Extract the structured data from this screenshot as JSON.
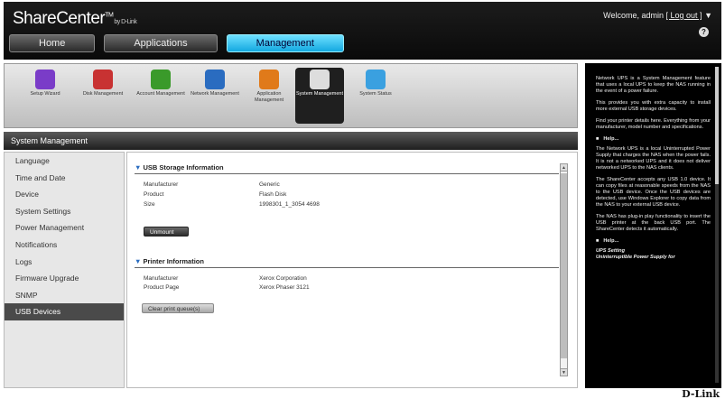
{
  "header": {
    "brand": "ShareCenter",
    "brand_tm": "TM",
    "brand_by": "by D-Link",
    "welcome": "Welcome, admin",
    "logout": "[ Log out ]",
    "dropdown_glyph": "▼",
    "help_glyph": "?"
  },
  "tabs": [
    {
      "label": "Home"
    },
    {
      "label": "Applications"
    },
    {
      "label": "Management"
    }
  ],
  "tools": [
    {
      "label": "Setup Wizard",
      "icon": "wizard-icon",
      "color": "#7a3cc8"
    },
    {
      "label": "Disk Management",
      "icon": "disk-icon",
      "color": "#c83232"
    },
    {
      "label": "Account Management",
      "icon": "account-icon",
      "color": "#3a9a2a"
    },
    {
      "label": "Network Management",
      "icon": "network-icon",
      "color": "#2a6cc0"
    },
    {
      "label": "Application Management",
      "icon": "application-icon",
      "color": "#e07a1a"
    },
    {
      "label": "System Management",
      "icon": "system-gear-icon",
      "color": "#dddddd"
    },
    {
      "label": "System Status",
      "icon": "info-icon",
      "color": "#3aa0e0"
    }
  ],
  "section_title": "System Management",
  "nav": [
    {
      "label": "Language"
    },
    {
      "label": "Time and Date"
    },
    {
      "label": "Device"
    },
    {
      "label": "System Settings"
    },
    {
      "label": "Power Management"
    },
    {
      "label": "Notifications"
    },
    {
      "label": "Logs"
    },
    {
      "label": "Firmware Upgrade"
    },
    {
      "label": "SNMP"
    },
    {
      "label": "USB Devices"
    }
  ],
  "usb_storage": {
    "title": "USB Storage Information",
    "rows": [
      {
        "key": "Manufacturer",
        "value": "Generic"
      },
      {
        "key": "Product",
        "value": "Flash Disk"
      },
      {
        "key": "Size",
        "value": "1998301_1_3054 4698"
      }
    ],
    "unmount_label": "Unmount"
  },
  "printer": {
    "title": "Printer Information",
    "rows": [
      {
        "key": "Manufacturer",
        "value": "Xerox Corporation"
      },
      {
        "key": "Product Page",
        "value": "Xerox Phaser 3121"
      }
    ],
    "clear_label": "Clear print queue(s)"
  },
  "help": {
    "p1": "Network UPS is a System Management feature that uses a local UPS to keep the NAS running in the event of a power failure.",
    "p2": "This provides you with extra capacity to install more external USB storage devices.",
    "p3": "Find your printer details here. Everything from your manufacturer, model number and specifications.",
    "h1": "Help...",
    "p4": "The Network UPS is a local Uninterrupted Power Supply that charges the NAS when the power fails. It is not a networked UPS and it does not deliver networked UPS to the NAS clients.",
    "p5": "The ShareCenter accepts any USB 1.0 device. It can copy files at reasonable speeds from the NAS to the USB device. Once the USB devices are detected, use Windows Explorer to copy data from the NAS to your external USB device.",
    "p6": "The NAS has plug-in play functionality to insert the USB printer at the back USB port. The ShareCenter detects it automatically.",
    "h2": "Help...",
    "h3": "UPS Setting",
    "p7": "Uninterruptible Power Supply for"
  },
  "footer_logo": "D-Link"
}
